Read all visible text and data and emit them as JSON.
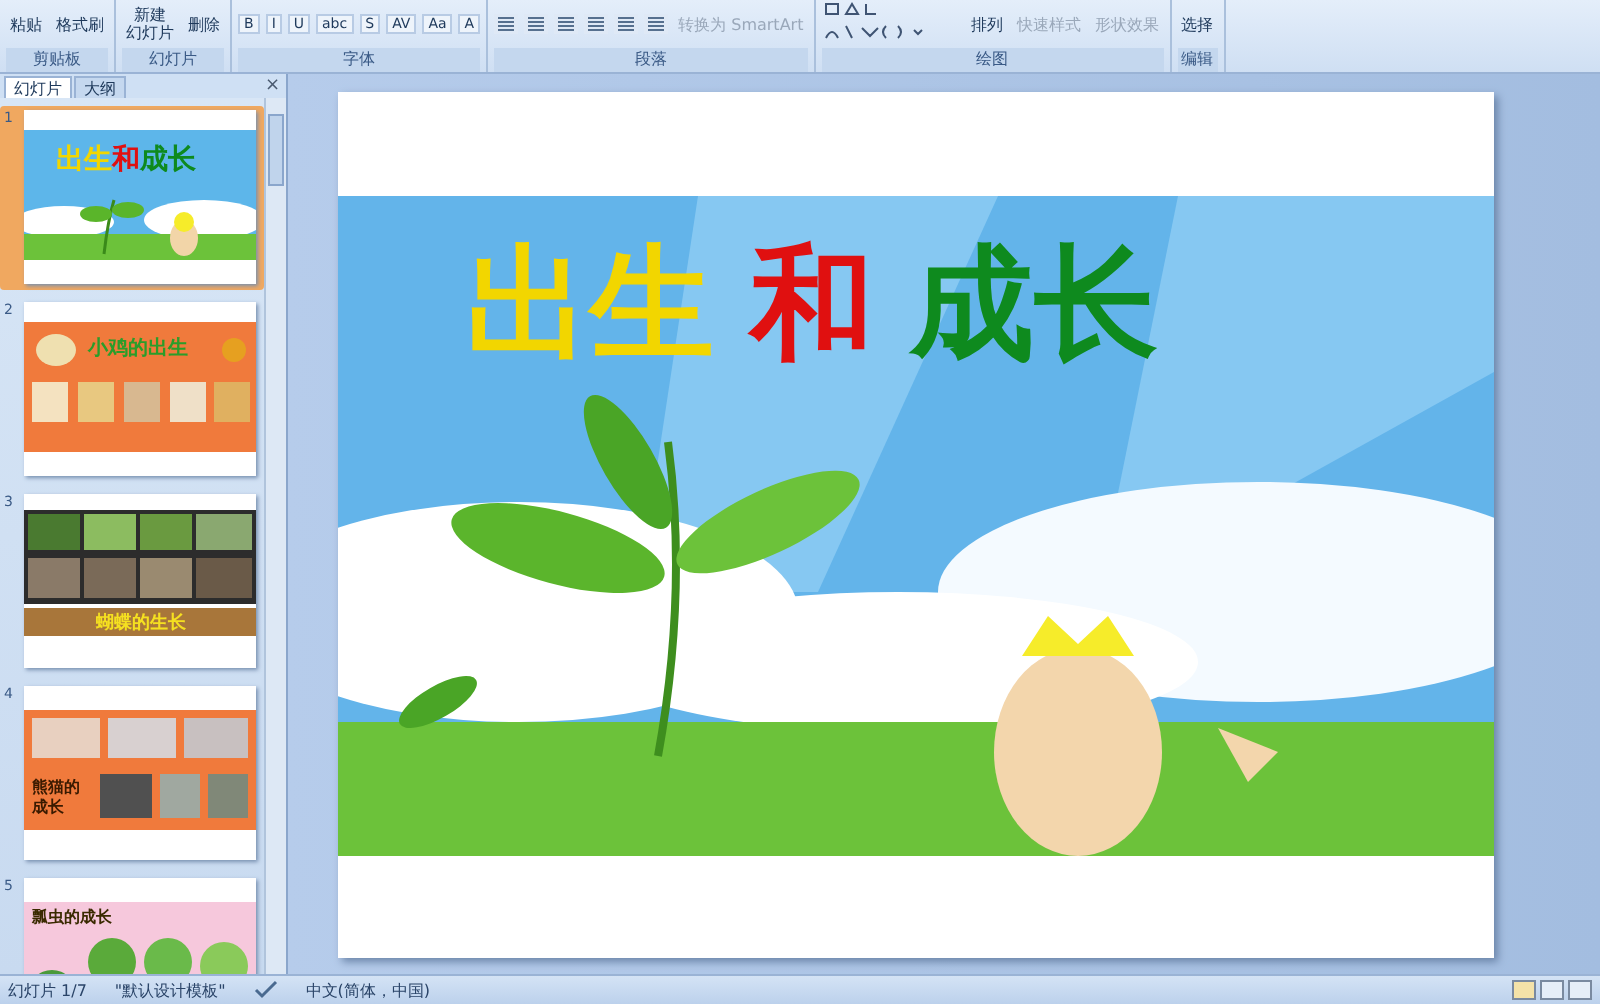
{
  "ribbon": {
    "groups": [
      {
        "label": "剪贴板",
        "items": [
          {
            "kind": "stack",
            "lines": [
              "粘贴"
            ],
            "disabled": false
          },
          {
            "kind": "small",
            "label": "格式刷",
            "disabled": false
          }
        ]
      },
      {
        "label": "幻灯片",
        "items": [
          {
            "kind": "stack",
            "lines": [
              "新建",
              "幻灯片"
            ],
            "disabled": false
          },
          {
            "kind": "small",
            "label": "删除",
            "disabled": false
          }
        ]
      },
      {
        "label": "字体",
        "items": [
          {
            "kind": "glyph",
            "label": "B"
          },
          {
            "kind": "glyph",
            "label": "I"
          },
          {
            "kind": "glyph",
            "label": "U"
          },
          {
            "kind": "glyph",
            "label": "abc"
          },
          {
            "kind": "glyph",
            "label": "S"
          },
          {
            "kind": "glyph",
            "label": "AV"
          },
          {
            "kind": "glyph",
            "label": "Aa"
          },
          {
            "kind": "glyph",
            "label": "A"
          }
        ]
      },
      {
        "label": "段落",
        "items": [
          {
            "kind": "align"
          },
          {
            "kind": "align"
          },
          {
            "kind": "align"
          },
          {
            "kind": "align"
          },
          {
            "kind": "align"
          },
          {
            "kind": "align"
          },
          {
            "kind": "small",
            "label": "转换为 SmartArt",
            "disabled": true
          }
        ]
      },
      {
        "label": "绘图",
        "items": [
          {
            "kind": "shapes"
          },
          {
            "kind": "stack",
            "lines": [
              "排列"
            ],
            "disabled": false
          },
          {
            "kind": "small",
            "label": "快速样式",
            "disabled": true
          },
          {
            "kind": "small",
            "label": "形状效果",
            "disabled": true
          }
        ]
      },
      {
        "label": "编辑",
        "items": [
          {
            "kind": "small",
            "label": "选择",
            "disabled": false
          }
        ]
      }
    ]
  },
  "panel": {
    "tabs": [
      {
        "label": "幻灯片",
        "selected": true
      },
      {
        "label": "大纲",
        "selected": false
      }
    ],
    "close": "×",
    "slides": [
      {
        "number": "1",
        "selected": true,
        "kind": "sky",
        "title_parts": [
          {
            "text": "出生",
            "color": "#f2d600"
          },
          {
            "text": "和",
            "color": "#e01010"
          },
          {
            "text": "成长",
            "color": "#0e8a1e"
          }
        ]
      },
      {
        "number": "2",
        "selected": false,
        "kind": "orange",
        "title_parts": [
          {
            "text": "小鸡的出生",
            "color": "#2a9d2a"
          }
        ]
      },
      {
        "number": "3",
        "selected": false,
        "kind": "photos",
        "title_parts": [
          {
            "text": "蝴蝶的生长",
            "color": "#f5e020"
          }
        ]
      },
      {
        "number": "4",
        "selected": false,
        "kind": "panda",
        "title_parts": [
          {
            "text": "熊猫的成长",
            "color": "#3a1a00"
          }
        ]
      },
      {
        "number": "5",
        "selected": false,
        "kind": "pink",
        "title_parts": [
          {
            "text": "瓢虫的成长",
            "color": "#3a2a00"
          }
        ]
      }
    ]
  },
  "slide": {
    "title_parts": [
      {
        "text": "出生",
        "color": "#f2d600"
      },
      {
        "text": "和",
        "color": "#e01010"
      },
      {
        "text": "成长",
        "color": "#0e8a1e"
      }
    ]
  },
  "status_bar": {
    "slide_counter": "幻灯片 1/7",
    "theme": "\"默认设计模板\"",
    "language": "中文(简体，中国)"
  }
}
